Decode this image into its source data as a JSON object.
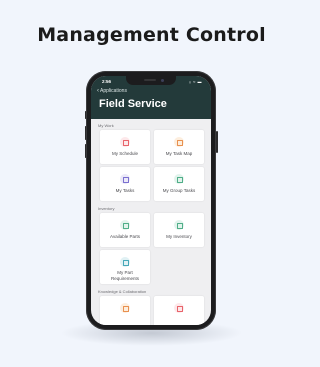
{
  "headline": "Management Control",
  "phone": {
    "status_time": "2:56",
    "status_icons": "ᵢᵢ ≈ ▬",
    "back_label": "Applications",
    "app_title": "Field Service"
  },
  "sections": [
    {
      "label": "My Work",
      "tiles": [
        {
          "label": "My Schedule",
          "icon": "calendar-icon",
          "color": "#e8636a",
          "bg": "#fde8ea"
        },
        {
          "label": "My Task Map",
          "icon": "map-icon",
          "color": "#e8904f",
          "bg": "#fdeede"
        },
        {
          "label": "My Tasks",
          "icon": "tasks-icon",
          "color": "#7a6fd0",
          "bg": "#ebe9f8"
        },
        {
          "label": "My Group Tasks",
          "icon": "group-tasks-icon",
          "color": "#4fae88",
          "bg": "#e2f3ec"
        }
      ]
    },
    {
      "label": "Inventory",
      "tiles": [
        {
          "label": "Available Parts",
          "icon": "parts-icon",
          "color": "#4fae88",
          "bg": "#e2f3ec"
        },
        {
          "label": "My Inventory",
          "icon": "inventory-icon",
          "color": "#4fae88",
          "bg": "#e2f3ec"
        },
        {
          "label": "My Part Requirements",
          "icon": "requirements-icon",
          "color": "#45a7b8",
          "bg": "#e0f1f4"
        }
      ]
    },
    {
      "label": "Knowledge & Collaboration",
      "tiles": [
        {
          "label": "",
          "icon": "knowledge-icon",
          "color": "#e8904f",
          "bg": "#fdeede"
        },
        {
          "label": "",
          "icon": "collaboration-icon",
          "color": "#e8636a",
          "bg": "#fde8ea"
        }
      ]
    }
  ]
}
